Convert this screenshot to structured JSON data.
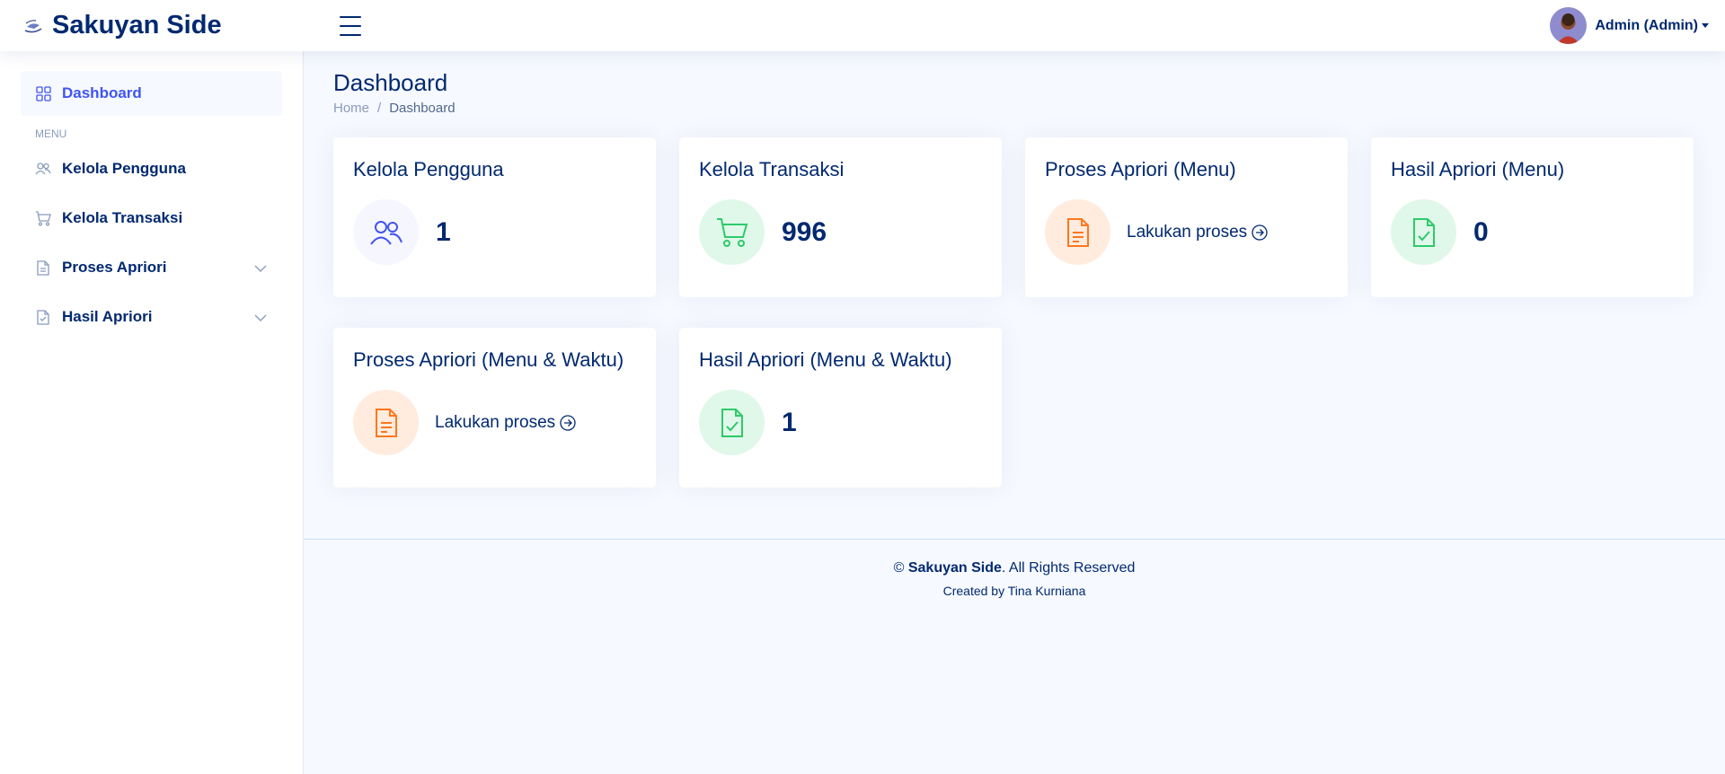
{
  "app": {
    "name": "Sakuyan Side"
  },
  "header": {
    "user_label": "Admin (Admin)"
  },
  "sidebar": {
    "dashboard": "Dashboard",
    "heading": "MENU",
    "items": [
      {
        "label": "Kelola Pengguna",
        "icon": "people-icon"
      },
      {
        "label": "Kelola Transaksi",
        "icon": "cart-icon"
      },
      {
        "label": "Proses Apriori",
        "icon": "document-icon",
        "expandable": true
      },
      {
        "label": "Hasil Apriori",
        "icon": "document-check-icon",
        "expandable": true
      }
    ]
  },
  "page": {
    "title": "Dashboard",
    "breadcrumb": {
      "home": "Home",
      "separator": "/",
      "current": "Dashboard"
    }
  },
  "cards": [
    {
      "title": "Kelola Pengguna",
      "value": "1",
      "icon": "people-icon",
      "color": "#4154f1"
    },
    {
      "title": "Kelola Transaksi",
      "value": "996",
      "icon": "cart-icon",
      "color": "#2eca6a"
    },
    {
      "title": "Proses Apriori (Menu)",
      "action": "Lakukan proses",
      "icon": "document-icon",
      "color": "#ff771d"
    },
    {
      "title": "Hasil Apriori (Menu)",
      "value": "0",
      "icon": "document-check-icon",
      "color": "#2eca6a"
    },
    {
      "title": "Proses Apriori (Menu & Waktu)",
      "action": "Lakukan proses",
      "icon": "document-icon",
      "color": "#ff771d"
    },
    {
      "title": "Hasil Apriori (Menu & Waktu)",
      "value": "1",
      "icon": "document-check-icon",
      "color": "#2eca6a"
    }
  ],
  "footer": {
    "copyright_symbol": "©",
    "brand": "Sakuyan Side",
    "rights": ". All Rights Reserved",
    "credits": "Created by Tina Kurniana"
  }
}
